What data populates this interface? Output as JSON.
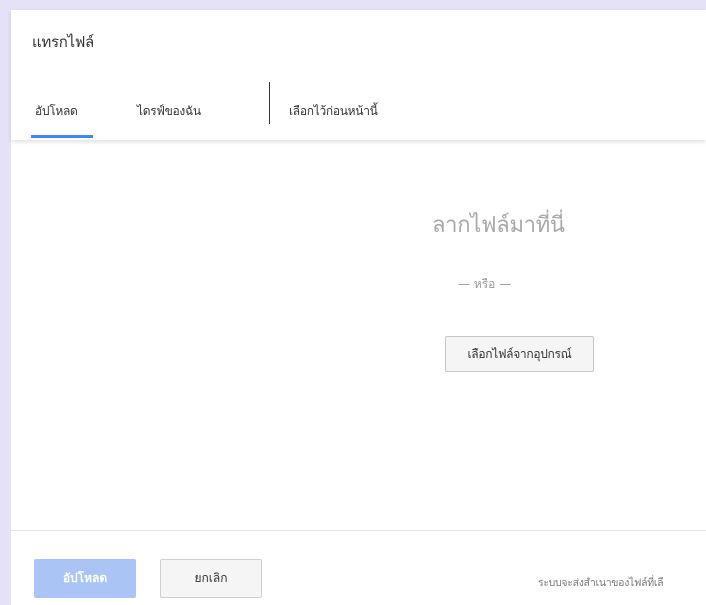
{
  "dialog": {
    "title": "แทรกไฟล์"
  },
  "tabs": [
    {
      "label": "อัปโหลด",
      "active": true
    },
    {
      "label": "ไดรฟ์ของฉัน",
      "active": false
    },
    {
      "label": "เลือกไว้ก่อนหน้านี้",
      "active": false
    }
  ],
  "upload": {
    "drop_text": "ลากไฟล์มาที่นี่",
    "or_text": "— หรือ —",
    "choose_button": "เลือกไฟล์จากอุปกรณ์"
  },
  "footer": {
    "upload_button": "อัปโหลด",
    "cancel_button": "ยกเลิก",
    "note": "ระบบจะส่งสำเนาของไฟล์ที่เลื"
  },
  "colors": {
    "accent": "#4285f4",
    "upload_button_disabled": "#a9c4f5",
    "background": "#e5e1f6"
  }
}
